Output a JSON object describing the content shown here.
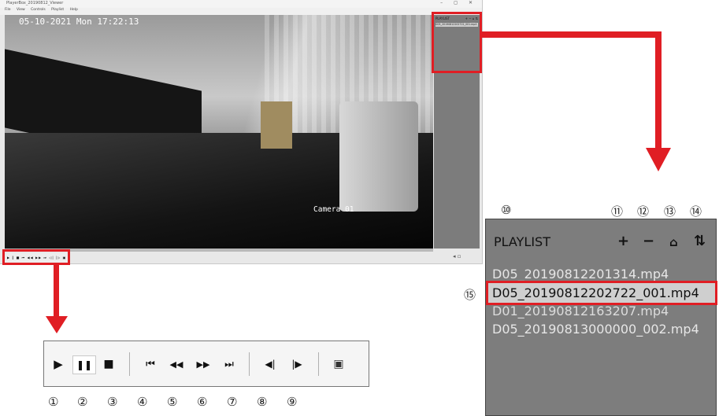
{
  "app": {
    "title": "PlayerBox_20190812_Viewer",
    "window_buttons": "–  ◻  ✕",
    "menu": [
      "File",
      "View",
      "Controls",
      "Playlist",
      "Help"
    ]
  },
  "video": {
    "datetime": "05-10-2021 Mon 17:22:13",
    "camera_label": "Camera 01"
  },
  "mini_playlist": {
    "title": "PLAYLIST",
    "icons": "+ − ⌂ ⇅",
    "selected_item": "D05_20190812202722_001.mp4"
  },
  "mini_controls": {
    "glyphs": "▶ ‖ ■  ⏮ ◀◀ ▶▶ ⏭  ◁| |▷  ▣"
  },
  "control_bar": {
    "play": "▶",
    "pause": "❚❚",
    "stop": "■",
    "prev": "⏮",
    "rewind": "◀◀",
    "fast_forward": "▶▶",
    "next": "⏭",
    "frame_back": "◀|",
    "frame_forward": "|▶",
    "snapshot": "▣",
    "numbers": [
      "①",
      "②",
      "③",
      "④",
      "⑤",
      "⑥",
      "⑦",
      "⑧",
      "⑨"
    ]
  },
  "playlist": {
    "title": "PLAYLIST",
    "add": "+",
    "remove": "−",
    "clear": "⌂",
    "sort": "⇅",
    "items": [
      "D05_20190812201314.mp4",
      "D05_20190812202722_001.mp4",
      "D01_20190812163207.mp4",
      "D05_20190813000000_002.mp4"
    ],
    "numbers": [
      "⑩",
      "⑪",
      "⑫",
      "⑬",
      "⑭",
      "⑮"
    ]
  },
  "colors": {
    "highlight": "#e01e24",
    "panel_gray": "#7d7d7d",
    "selected_row": "#cfcfcf"
  }
}
